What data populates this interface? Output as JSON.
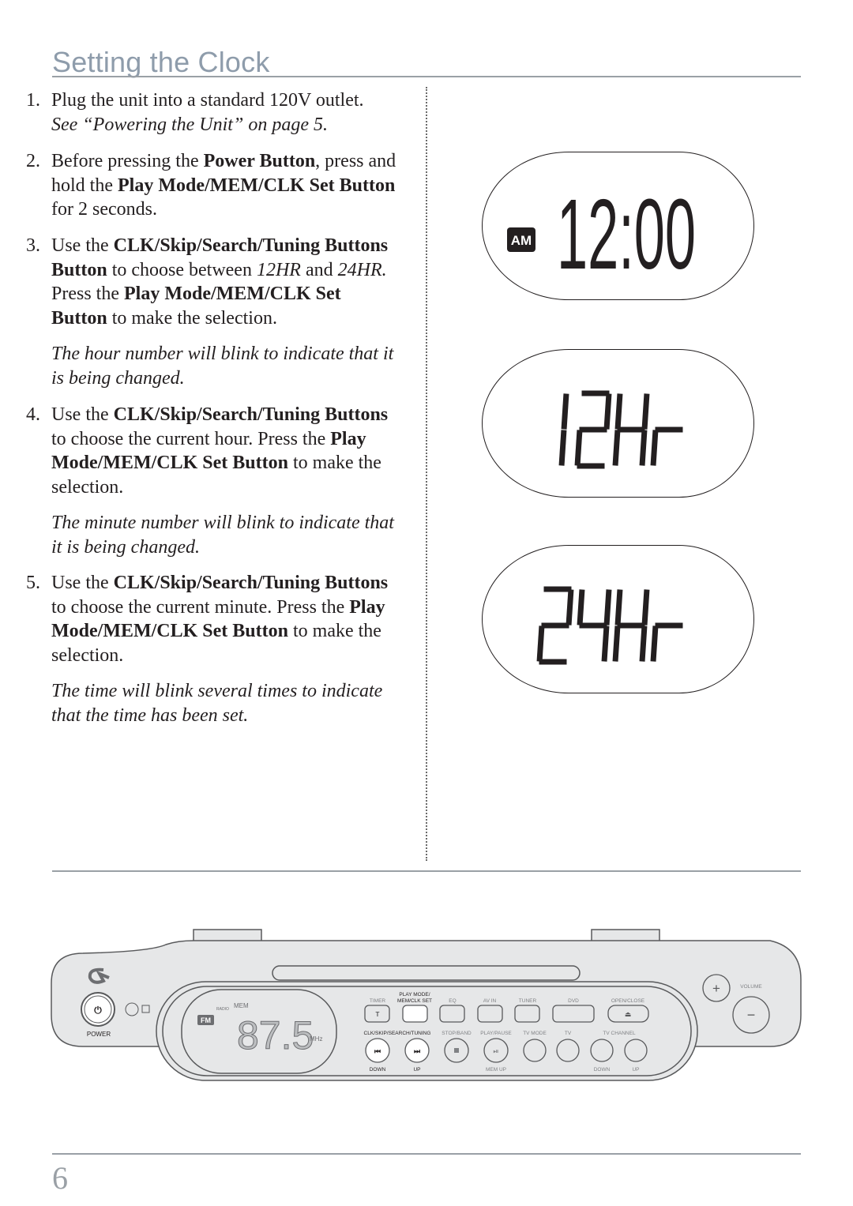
{
  "page": {
    "title": "Setting the Clock",
    "page_number": "6"
  },
  "instructions": [
    {
      "num": "1.",
      "lines": [
        [
          {
            "t": "Plug the unit into a standard 120V outlet."
          }
        ],
        [
          {
            "t": "See “Powering the Unit” on page 5.",
            "s": "i"
          }
        ]
      ]
    },
    {
      "num": "2.",
      "lines": [
        [
          {
            "t": "Before pressing the "
          },
          {
            "t": "Power Button",
            "s": "b"
          },
          {
            "t": ", press and"
          }
        ],
        [
          {
            "t": "hold the "
          },
          {
            "t": "Play Mode/MEM/CLK Set Button",
            "s": "b"
          }
        ],
        [
          {
            "t": "for 2 seconds."
          }
        ]
      ]
    },
    {
      "num": "3.",
      "lines": [
        [
          {
            "t": "Use the "
          },
          {
            "t": "CLK/Skip/Search/Tuning Buttons",
            "s": "b"
          }
        ],
        [
          {
            "t": "Button",
            "s": "b"
          },
          {
            "t": " to choose between "
          },
          {
            "t": "12HR",
            "s": "i"
          },
          {
            "t": " and "
          },
          {
            "t": "24HR.",
            "s": "i"
          }
        ],
        [
          {
            "t": "Press the "
          },
          {
            "t": "Play Mode/MEM/CLK Set",
            "s": "b"
          }
        ],
        [
          {
            "t": "Button",
            "s": "b"
          },
          {
            "t": " to make the selection."
          }
        ]
      ]
    },
    {
      "num": "",
      "lines": [
        [
          {
            "t": "The hour number will blink to indicate that it",
            "s": "i"
          }
        ],
        [
          {
            "t": "is being changed.",
            "s": "i"
          }
        ]
      ]
    },
    {
      "num": "4.",
      "lines": [
        [
          {
            "t": "Use the "
          },
          {
            "t": "CLK/Skip/Search/Tuning Buttons",
            "s": "b"
          }
        ],
        [
          {
            "t": "to choose the current hour.  Press the "
          },
          {
            "t": "Play",
            "s": "b"
          }
        ],
        [
          {
            "t": "Mode/MEM/CLK Set Button",
            "s": "b"
          },
          {
            "t": " to make the"
          }
        ],
        [
          {
            "t": "selection."
          }
        ]
      ]
    },
    {
      "num": "",
      "lines": [
        [
          {
            "t": "The minute number will blink to indicate that",
            "s": "i"
          }
        ],
        [
          {
            "t": "it is being changed.",
            "s": "i"
          }
        ]
      ]
    },
    {
      "num": "5.",
      "lines": [
        [
          {
            "t": "Use the "
          },
          {
            "t": "CLK/Skip/Search/Tuning Buttons",
            "s": "b"
          }
        ],
        [
          {
            "t": "to choose the current minute.  Press the "
          },
          {
            "t": "Play",
            "s": "b"
          }
        ],
        [
          {
            "t": "Mode/MEM/CLK Set Button",
            "s": "b"
          },
          {
            "t": " to make the"
          }
        ],
        [
          {
            "t": "selection."
          }
        ]
      ]
    },
    {
      "num": "",
      "lines": [
        [
          {
            "t": "The time will blink several times to indicate",
            "s": "i"
          }
        ],
        [
          {
            "t": "that the time has been set.",
            "s": "i"
          }
        ]
      ]
    }
  ],
  "displays": [
    {
      "badge": "AM",
      "text": "12:00"
    },
    {
      "badge": "",
      "text": "12Hr"
    },
    {
      "badge": "",
      "text": "24Hr"
    }
  ],
  "device": {
    "power_label": "POWER",
    "band_badge": "FM",
    "radio_label": "RADIO",
    "mem_label": "MEM",
    "frequency": "87.5",
    "unit": "MHz",
    "timer_label": "TIMER",
    "timer_key": "T",
    "playmode_label_1": "PLAY MODE/",
    "playmode_label_2": "MEM/CLK SET",
    "eq_label": "EQ",
    "avin_label": "AV IN",
    "tuner_label": "TUNER",
    "dvd_label": "DVD",
    "open_close_label": "OPEN/CLOSE",
    "clk_label": "CLK/SKIP/SEARCH/TUNING",
    "stop_band_label": "STOP/BAND",
    "play_pause_label": "PLAY/PAUSE",
    "tv_mode_label": "TV MODE",
    "tv_label": "TV",
    "tv_channel_label": "TV CHANNEL",
    "down_label": "DOWN",
    "up_label": "UP",
    "mem_up_label": "MEM UP",
    "tv_down_label": "DOWN",
    "tv_up_label": "UP",
    "volume_label": "VOLUME",
    "volume_up_key": "+",
    "volume_down_key": "−"
  },
  "colors": {
    "title": "#8e9cab",
    "device_body": "#e6e7e8",
    "device_outline": "#58595b"
  }
}
